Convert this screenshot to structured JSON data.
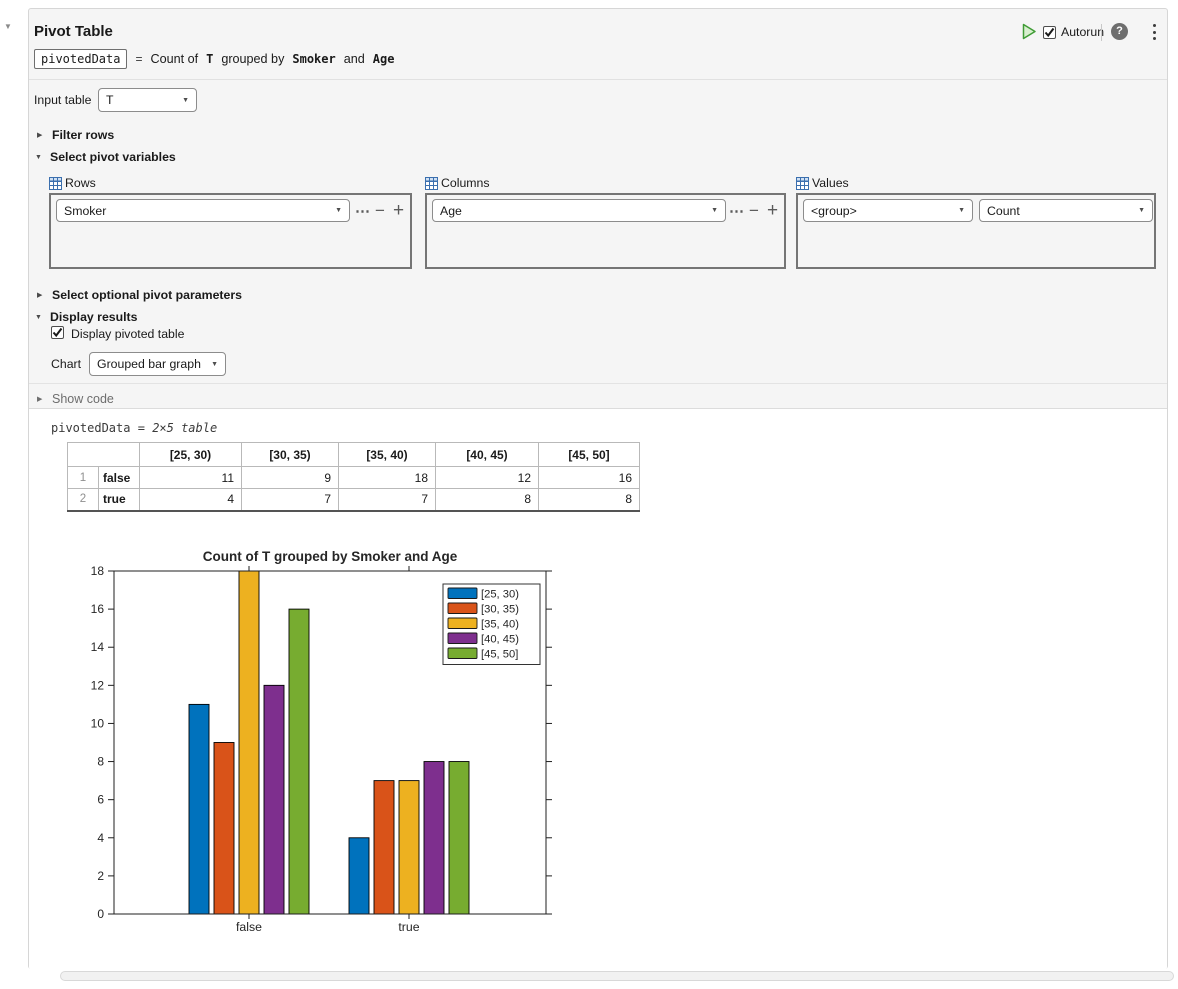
{
  "task": {
    "title": "Pivot Table",
    "autorun_label": "Autorun",
    "formula": {
      "output_var": "pivotedData",
      "equals": "=",
      "count_of": "Count of",
      "table_var": "T",
      "grouped_by": "grouped by",
      "row_var": "Smoker",
      "and_word": "and",
      "col_var": "Age"
    }
  },
  "controls": {
    "input_table_label": "Input table",
    "input_table_value": "T",
    "filter_rows_label": "Filter rows",
    "select_pivot_variables_label": "Select pivot variables",
    "rows_panel_label": "Rows",
    "rows_value": "Smoker",
    "columns_panel_label": "Columns",
    "columns_value": "Age",
    "values_panel_label": "Values",
    "values_group_value": "<group>",
    "values_method_value": "Count",
    "select_optional_label": "Select optional pivot parameters",
    "display_results_label": "Display results",
    "display_pivoted_table_label": "Display pivoted table",
    "chart_label": "Chart",
    "chart_value": "Grouped bar graph",
    "show_code_label": "Show code"
  },
  "icons": {
    "ellipsis": "⋯",
    "minus": "−",
    "plus": "+",
    "dropdown_arrow": "▼",
    "collapsed_arrow": "▶",
    "expanded_arrow": "▼",
    "help_glyph": "?",
    "task_collapse_arrow": "▼"
  },
  "output": {
    "result_var": "pivotedData",
    "result_equals": "=",
    "result_dims": "2×5 table",
    "table": {
      "columns": [
        "[25, 30)",
        "[30, 35)",
        "[35, 40)",
        "[40, 45)",
        "[45, 50]"
      ],
      "rows": [
        {
          "index": "1",
          "name": "false",
          "values": [
            "11",
            "9",
            "18",
            "12",
            "16"
          ]
        },
        {
          "index": "2",
          "name": "true",
          "values": [
            "4",
            "7",
            "7",
            "8",
            "8"
          ]
        }
      ]
    }
  },
  "chart_data": {
    "type": "bar",
    "title": "Count of T grouped by Smoker and Age",
    "categories": [
      "false",
      "true"
    ],
    "series": [
      {
        "name": "[25, 30)",
        "color": "#0072BD",
        "values": [
          11,
          4
        ]
      },
      {
        "name": "[30, 35)",
        "color": "#D95319",
        "values": [
          9,
          7
        ]
      },
      {
        "name": "[35, 40)",
        "color": "#EDB120",
        "values": [
          18,
          7
        ]
      },
      {
        "name": "[40, 45)",
        "color": "#7E2F8E",
        "values": [
          12,
          8
        ]
      },
      {
        "name": "[45, 50]",
        "color": "#77AC30",
        "values": [
          16,
          8
        ]
      }
    ],
    "ylim": [
      0,
      18
    ],
    "yticks": [
      0,
      2,
      4,
      6,
      8,
      10,
      12,
      14,
      16,
      18
    ],
    "xlabel": "",
    "ylabel": "",
    "legend_position": "northeast",
    "grid": false,
    "bar_edge_color": "#000000"
  },
  "colors": {
    "run_green": "#3f9c35",
    "panel_border": "#757575",
    "section_bg": "#f5f5f5",
    "table_icon_blue": "#3b6fae"
  }
}
